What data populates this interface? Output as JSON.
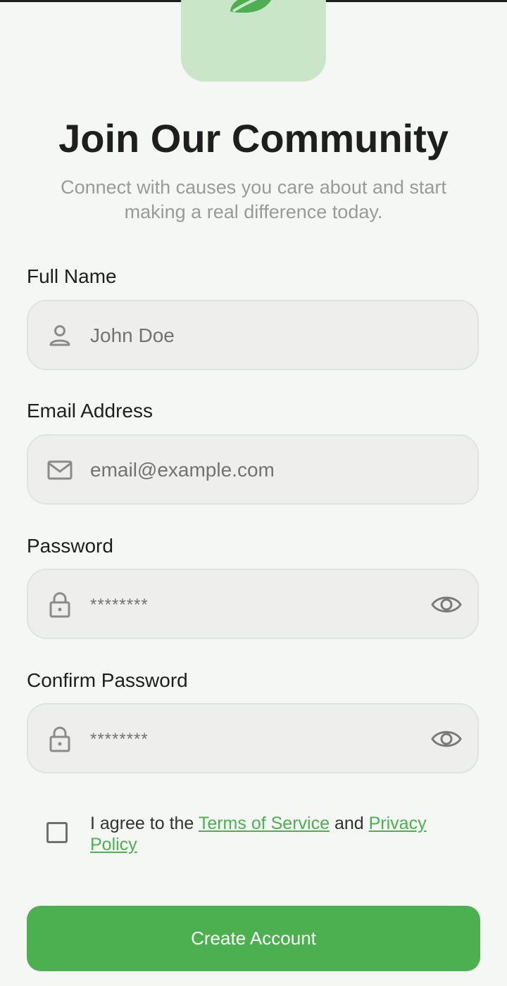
{
  "header": {
    "title": "Join Our Community",
    "subtitle": "Connect with causes you care about and start making a real difference today."
  },
  "form": {
    "full_name": {
      "label": "Full Name",
      "placeholder": "John Doe",
      "icon": "person-icon"
    },
    "email": {
      "label": "Email Address",
      "placeholder": "email@example.com",
      "icon": "mail-icon"
    },
    "password": {
      "label": "Password",
      "value": "********",
      "icon": "lock-icon",
      "toggle_icon": "eye-icon"
    },
    "confirm_password": {
      "label": "Confirm Password",
      "value": "********",
      "icon": "lock-icon",
      "toggle_icon": "eye-icon"
    }
  },
  "agreement": {
    "prefix": "I agree to the ",
    "terms_link": "Terms of Service",
    "middle": " and ",
    "privacy_link": "Privacy Policy",
    "checked": false
  },
  "cta": {
    "label": "Create Account"
  },
  "colors": {
    "primary": "#4caf50",
    "logo_bg": "#c9e6c9",
    "background": "#f5f7f4",
    "field_bg": "#eeefed",
    "muted_text": "#9a9a9a"
  }
}
